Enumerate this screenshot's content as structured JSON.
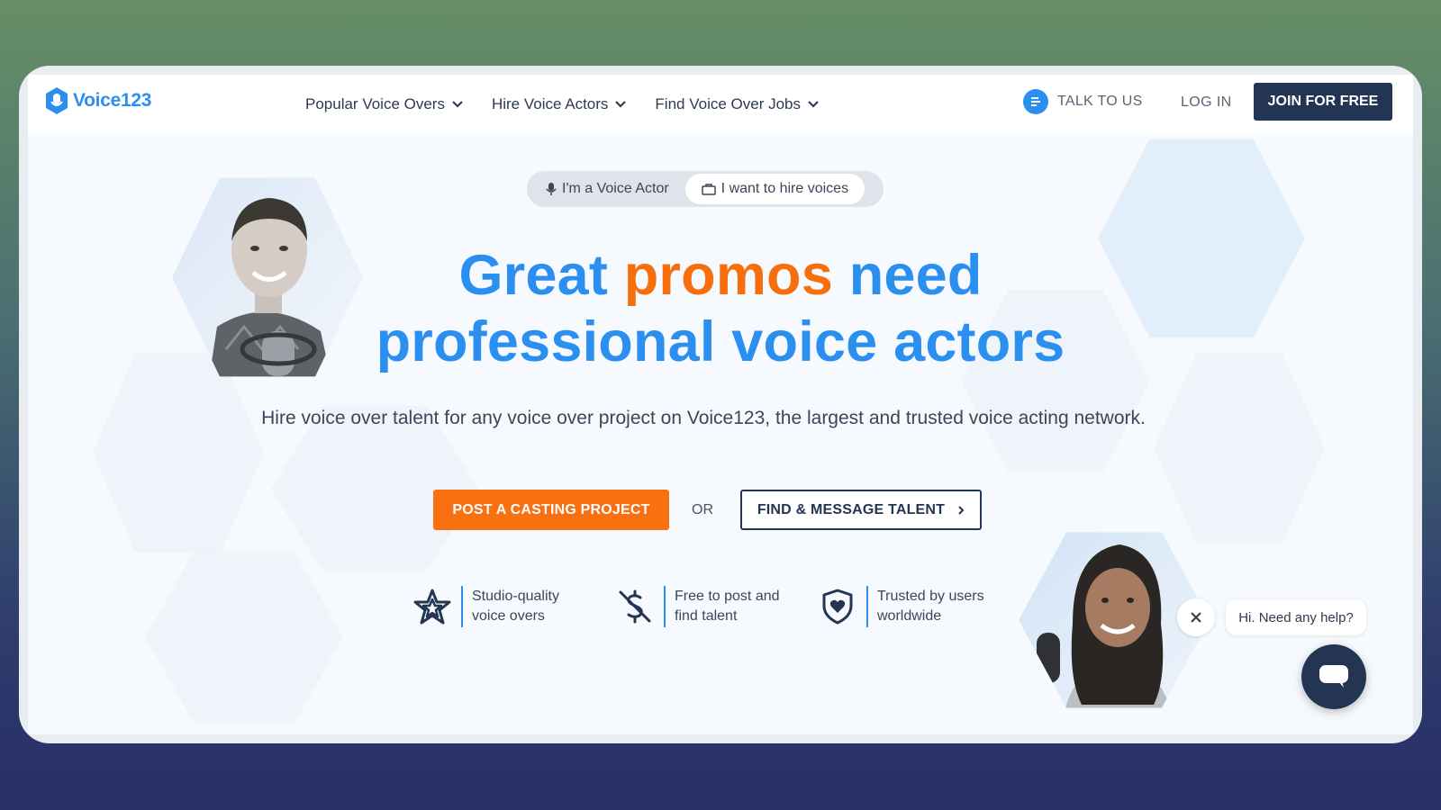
{
  "header": {
    "logo_text": "Voice123",
    "nav": [
      {
        "label": "Popular Voice Overs"
      },
      {
        "label": "Hire Voice Actors"
      },
      {
        "label": "Find Voice Over Jobs"
      }
    ],
    "talk_label": "TALK TO US",
    "login_label": "LOG IN",
    "join_label": "JOIN FOR FREE"
  },
  "toggle": {
    "voice_actor_label": "I'm a Voice Actor",
    "hire_label": "I want to hire voices",
    "active": "hire"
  },
  "hero": {
    "headline_word1": "Great",
    "headline_accent": "promos",
    "headline_word3": "need",
    "headline_line2": "professional voice actors",
    "subtitle": "Hire voice over talent for any voice over project on Voice123, the largest and trusted voice acting network."
  },
  "cta": {
    "post_label": "POST A CASTING PROJECT",
    "or_label": "OR",
    "find_label": "FIND & MESSAGE TALENT"
  },
  "features": [
    {
      "line1": "Studio-quality",
      "line2": "voice overs",
      "icon": "star-icon"
    },
    {
      "line1": "Free to post and",
      "line2": "find talent",
      "icon": "no-dollar-icon"
    },
    {
      "line1": "Trusted by users",
      "line2": "worldwide",
      "icon": "shield-heart-icon"
    }
  ],
  "chat": {
    "prompt": "Hi. Need any help?"
  },
  "colors": {
    "brand_blue": "#2b8ff0",
    "accent_orange": "#f76f0d",
    "navy": "#233552"
  }
}
